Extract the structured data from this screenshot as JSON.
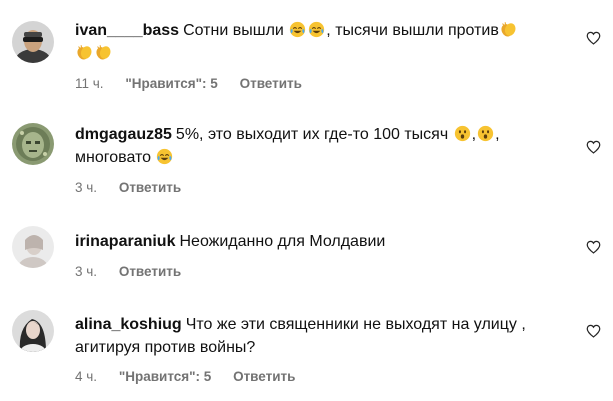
{
  "comments": [
    {
      "username": "ivan____bass",
      "text_1": "Сотни вышли",
      "text_2": ", тысячи вышли против",
      "time": "11 ч.",
      "likes": "\"Нравится\": 5",
      "reply": "Ответить",
      "emojis": [
        "laughing-crying-emoji",
        "laughing-crying-emoji",
        "clapping-hands-emoji",
        "clapping-hands-emoji",
        "clapping-hands-emoji"
      ]
    },
    {
      "username": "dmgagauz85",
      "text_1": "5%, это выходит их где-то 100 тысяч",
      "text_2": ",",
      "text_3": "многовато",
      "time": "3 ч.",
      "reply": "Ответить",
      "emojis": [
        "astonished-face-emoji",
        "astonished-face-emoji",
        "laughing-crying-emoji"
      ]
    },
    {
      "username": "irinaparaniuk",
      "text_1": "Неожиданно для Молдавии",
      "time": "3 ч.",
      "reply": "Ответить"
    },
    {
      "username": "alina_koshiug",
      "text_1": "Что же эти священники не выходят на улицу ,",
      "text_2": "агитируя против войны?",
      "time": "4 ч.",
      "likes": "\"Нравится\": 5",
      "reply": "Ответить"
    }
  ],
  "colors": {
    "text": "#111111",
    "meta": "#737373",
    "heart_stroke": "#262626",
    "emoji_yellow": "#f7c331"
  }
}
